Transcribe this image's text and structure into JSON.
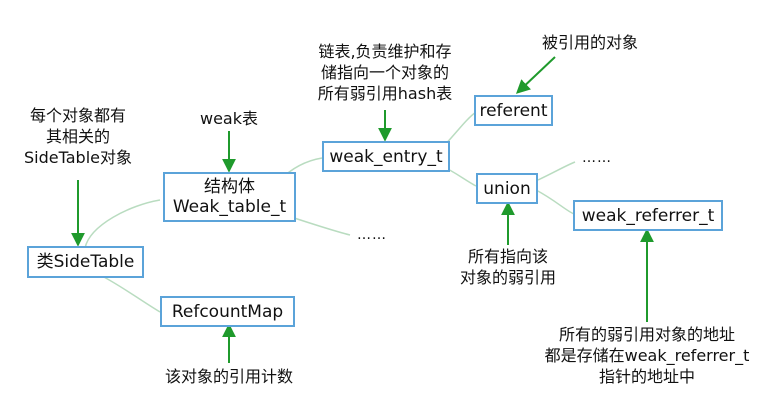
{
  "nodes": {
    "side_table": "类SideTable",
    "weak_table_line1": "结构体",
    "weak_table_line2": "Weak_table_t",
    "refcount_map": "RefcountMap",
    "weak_entry": "weak_entry_t",
    "referent": "referent",
    "union": "union",
    "weak_referrer": "weak_referrer_t"
  },
  "notes": {
    "side_table": [
      "每个对象都有",
      "其相关的",
      "SideTable对象"
    ],
    "weak_table": [
      "weak表"
    ],
    "refcount": [
      "该对象的引用计数"
    ],
    "weak_entry": [
      "链表,负责维护和存",
      "储指向一个对象的",
      "所有弱引用hash表"
    ],
    "referent": [
      "被引用的对象"
    ],
    "union": [
      "所有指向该",
      "对象的弱引用"
    ],
    "weak_referrer": [
      "所有的弱引用对象的地址",
      "都是存储在weak_referrer_t",
      "指针的地址中"
    ]
  },
  "ellipsis": {
    "weak_table": "……",
    "union": "……"
  },
  "colors": {
    "box_border": "#5ba3d9",
    "arrow": "#1f9a2c",
    "connector": "#b9dcc0"
  }
}
